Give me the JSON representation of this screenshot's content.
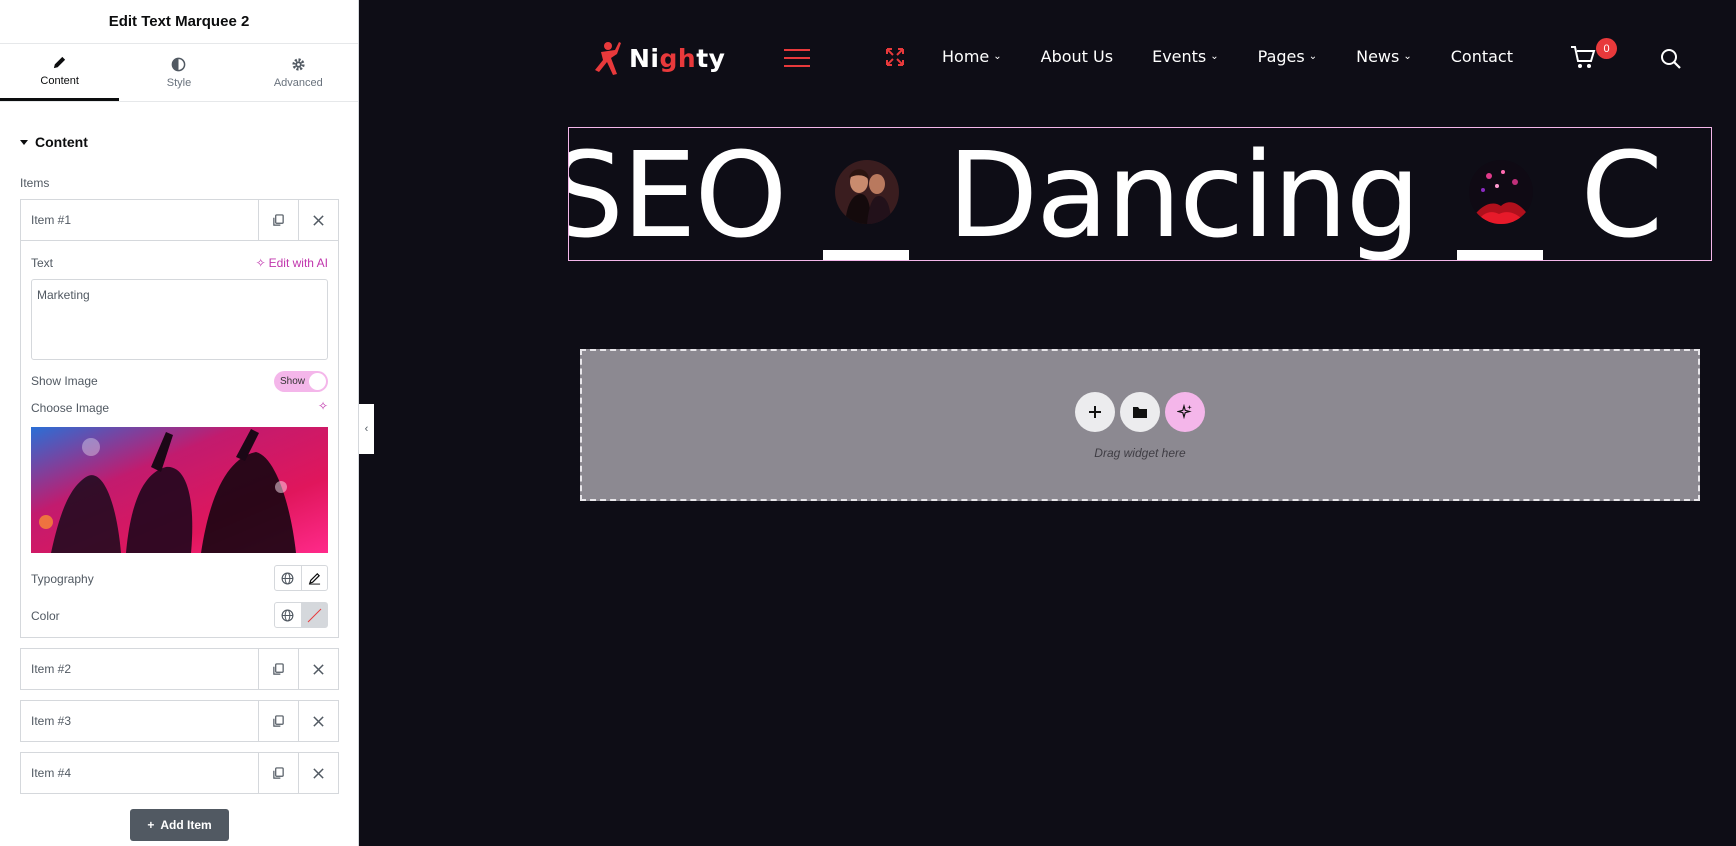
{
  "panel": {
    "title": "Edit Text Marquee 2",
    "tabs": [
      {
        "label": "Content",
        "icon": "pencil-icon",
        "active": true
      },
      {
        "label": "Style",
        "icon": "half-circle-icon",
        "active": false
      },
      {
        "label": "Advanced",
        "icon": "gear-icon",
        "active": false
      }
    ],
    "section": "Content",
    "items_label": "Items",
    "items": [
      {
        "title": "Item #1",
        "expanded": true
      },
      {
        "title": "Item #2",
        "expanded": false
      },
      {
        "title": "Item #3",
        "expanded": false
      },
      {
        "title": "Item #4",
        "expanded": false
      }
    ],
    "item1": {
      "text_label": "Text",
      "edit_ai": "Edit with AI",
      "text_value": "Marketing",
      "show_image_label": "Show Image",
      "toggle_label": "Show",
      "choose_image_label": "Choose Image",
      "typography_label": "Typography",
      "color_label": "Color"
    },
    "add_item": "Add Item"
  },
  "site": {
    "logo_prefix": "Ni",
    "logo_accent": "gh",
    "logo_suffix": "ty",
    "nav": [
      {
        "label": "Home",
        "dropdown": true
      },
      {
        "label": "About Us",
        "dropdown": false
      },
      {
        "label": "Events",
        "dropdown": true
      },
      {
        "label": "Pages",
        "dropdown": true
      },
      {
        "label": "News",
        "dropdown": true
      },
      {
        "label": "Contact",
        "dropdown": false
      }
    ],
    "cart_count": "0",
    "marquee_words": [
      "SEO",
      "Dancing",
      "C"
    ],
    "drop_hint": "Drag widget here"
  },
  "colors": {
    "accent": "#e8393b",
    "ai_pink": "#f4b6ea",
    "site_bg": "#0e0d16",
    "panel_button": "#515962"
  }
}
